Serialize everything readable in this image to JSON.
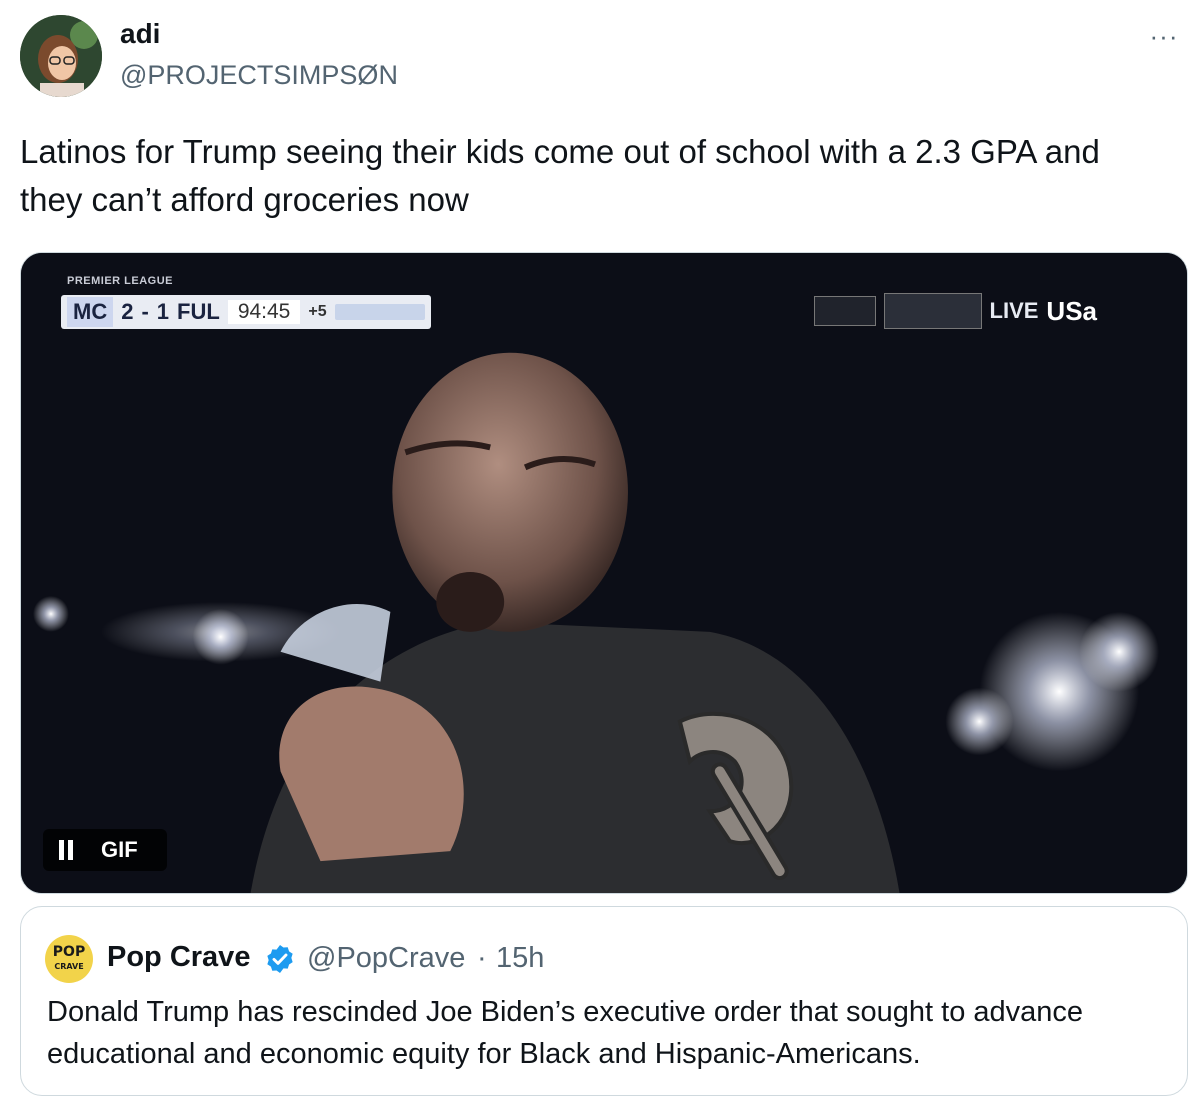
{
  "author": {
    "display_name": "adi",
    "handle": "@PROJECTSIMPSØN"
  },
  "more_label": "···",
  "tweet_text": "Latinos for Trump seeing their kids come out of school with a 2.3 GPA and they can’t afford groceries now",
  "media": {
    "scorebug": {
      "league": "PREMIER LEAGUE",
      "home_team": "MC",
      "home_score": "2",
      "dash": "-",
      "away_score": "1",
      "away_team": "FUL",
      "clock": "94:45",
      "added_time": "+5"
    },
    "broadcast": {
      "live": "LIVE",
      "network": "USa"
    },
    "gif_label": "GIF",
    "pause_icon": "pause-icon"
  },
  "quoted": {
    "avatar_text_top": "POP",
    "avatar_text_bottom": "CRAVE",
    "display_name": "Pop Crave",
    "handle": "@PopCrave",
    "separator": "·",
    "time": "15h",
    "text": "Donald Trump has rescinded Joe Biden’s executive order that sought to advance educational and economic equity for Black and Hispanic-Americans.",
    "verified_color": "#1d9bf0"
  }
}
